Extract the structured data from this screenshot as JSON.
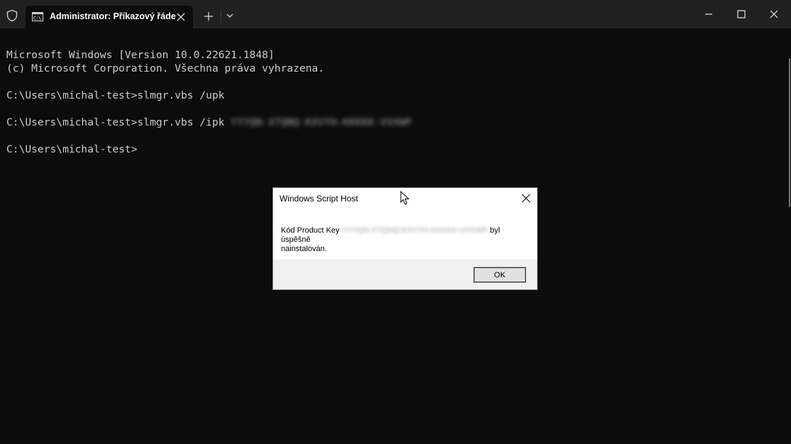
{
  "window": {
    "tab_title": "Administrator: Příkazový řáde",
    "icons": {
      "shield": "shield-icon",
      "tab": "cmd-icon",
      "tab_close": "close-icon",
      "new_tab": "plus-icon",
      "dropdown": "chevron-down-icon",
      "minimize": "minimize-icon",
      "maximize": "maximize-icon",
      "close": "close-icon"
    }
  },
  "terminal": {
    "lines": {
      "l1": "Microsoft Windows [Version 10.0.22621.1848]",
      "l2": "(c) Microsoft Corporation. Všechna práva vyhrazena.",
      "l3": "C:\\Users\\michal-test>slmgr.vbs /upk",
      "l4_prefix": "C:\\Users\\michal-test>slmgr.vbs /ipk ",
      "l4_redacted": "YYYQN-XTQNQ-KXVYH-KKKKK-VVXWP",
      "l5": "C:\\Users\\michal-test>"
    }
  },
  "dialog": {
    "title": "Windows Script Host",
    "message_prefix": "Kód Product Key ",
    "message_redacted": "YYYQN-XTQNQ-KXVYH-KKKKK-VVXWP",
    "message_suffix": " byl úspěšně",
    "message_line2": "nainstalován.",
    "ok_label": "OK"
  }
}
